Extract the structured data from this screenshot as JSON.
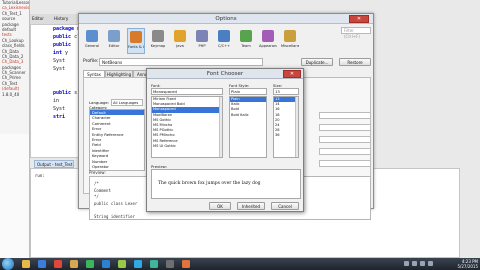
{
  "ide": {
    "sidebar_items": [
      "TutorialLessons",
      "ca_Lexisnexis",
      "Ch_Test_1",
      "source",
      "package",
      "default",
      "tests",
      "Ch_Lookup",
      "class_fields",
      "Ch_Data",
      "Ch_Data_2",
      "Ch_Data_3",
      "packages",
      "Ch_Scanner",
      "Ch_Prime",
      "Ch_Test",
      "(default)",
      "1.8.0_40"
    ],
    "editor_tab": "Editor",
    "history_tab": "History",
    "code_lines": [
      "package m",
      "public cl",
      "  public",
      "  int y",
      "  Syst",
      "  Syst",
      "",
      "",
      "public s",
      "  in",
      "  Syst",
      "  stri"
    ],
    "output_tab": "Output - test_Test",
    "output_lines": [
      "run:",
      "BUILD SUCCESSFUL"
    ]
  },
  "options": {
    "title": "Options",
    "close_glyph": "✕",
    "search_placeholder": "Filter (Ctrl+F)",
    "categories": [
      {
        "label": "General",
        "color": "#5b8fd0"
      },
      {
        "label": "Editor",
        "color": "#7a9fca"
      },
      {
        "label": "Fonts & Colors",
        "color": "#d97a2b"
      },
      {
        "label": "Keymap",
        "color": "#8a8a8a"
      },
      {
        "label": "Java",
        "color": "#e2a32c"
      },
      {
        "label": "PHP",
        "color": "#7c83b5"
      },
      {
        "label": "C/C++",
        "color": "#4a7fc1"
      },
      {
        "label": "Team",
        "color": "#58a34e"
      },
      {
        "label": "Appearance",
        "color": "#a35bb8"
      },
      {
        "label": "Miscellaneous",
        "color": "#c9a03d"
      }
    ],
    "active_category": "Fonts & Colors",
    "profile_label": "Profile:",
    "profile_value": "NetBeans",
    "duplicate_label": "Duplicate...",
    "restore_label": "Restore",
    "subtabs": [
      "Syntax",
      "Highlighting",
      "Annotations"
    ],
    "language_tabs": [
      "Language:",
      "All Languages"
    ],
    "category_label": "Category:",
    "category_items": [
      "Default",
      "Character",
      "Comment",
      "Error",
      "Entity Reference",
      "Error",
      "Field",
      "Identifier",
      "Keyword",
      "Number",
      "Operator",
      "Preprocessor",
      "String",
      "Whitespace"
    ],
    "selected_category": "Default",
    "preview_label": "Preview:",
    "preview_lines": [
      "/*",
      "  Comment",
      "*/",
      "public class Lexer",
      "",
      "    String identifier"
    ]
  },
  "font_dialog": {
    "title": "Font Chooser",
    "close_glyph": "✕",
    "font_label": "Font:",
    "font_value": "Monospaced",
    "style_label": "Font Style:",
    "style_value": "Plain",
    "size_label": "Size:",
    "size_value": "13",
    "fonts": [
      "Miriam Fixed",
      "Monospaced Bold",
      "Monospaced",
      "MoolBoran",
      "MS Gothic",
      "MS Mincho",
      "MS PGothic",
      "MS PMincho",
      "MS Reference",
      "MS UI Gothic"
    ],
    "selected_font": "Monospaced",
    "styles": [
      "Plain",
      "Italic",
      "Bold",
      "Bold Italic"
    ],
    "selected_style": "Plain",
    "sizes": [
      "13",
      "14",
      "16",
      "18",
      "20",
      "24",
      "28",
      "36"
    ],
    "selected_size": "13",
    "preview_label": "Preview:",
    "preview_text": "The quick brown fox jumps over the lazy dog",
    "ok_label": "OK",
    "inherit_label": "Inherited",
    "cancel_label": "Cancel"
  },
  "taskbar": {
    "icons": [
      {
        "name": "explorer-icon",
        "color": "#e8b84a"
      },
      {
        "name": "media-icon",
        "color": "#3b7dd8"
      },
      {
        "name": "chrome-icon",
        "color": "#e0463a"
      },
      {
        "name": "folder-icon",
        "color": "#d8a84e"
      },
      {
        "name": "spotify-icon",
        "color": "#3cb65a"
      },
      {
        "name": "app-icon",
        "color": "#2e80d1"
      },
      {
        "name": "netbeans-icon",
        "color": "#9ac84a"
      },
      {
        "name": "skype-icon",
        "color": "#2fa9e0"
      },
      {
        "name": "cube-icon",
        "color": "#3fb69a"
      },
      {
        "name": "game-icon",
        "color": "#6f6f6f"
      },
      {
        "name": "java-icon",
        "color": "#e0743a"
      }
    ],
    "time": "4:23 PM",
    "date": "5/27/2015"
  }
}
